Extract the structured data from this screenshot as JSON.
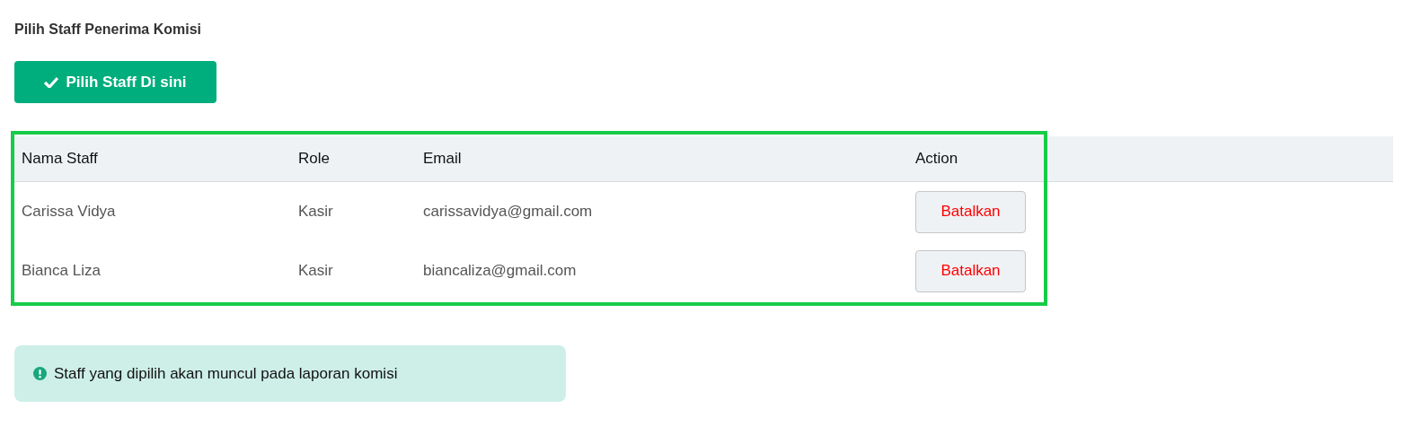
{
  "heading": "Pilih Staff Penerima Komisi",
  "select_button": {
    "label": "Pilih Staff Di sini"
  },
  "table": {
    "highlighted": true,
    "columns": [
      "Nama Staff",
      "Role",
      "Email",
      "Action"
    ],
    "rows": [
      {
        "name": "Carissa Vidya",
        "role": "Kasir",
        "email": "carissavidya@gmail.com",
        "action": "Batalkan"
      },
      {
        "name": "Bianca Liza",
        "role": "Kasir",
        "email": "biancaliza@gmail.com",
        "action": "Batalkan"
      }
    ]
  },
  "alert": {
    "text": "Staff yang dipilih akan muncul pada laporan komisi"
  }
}
